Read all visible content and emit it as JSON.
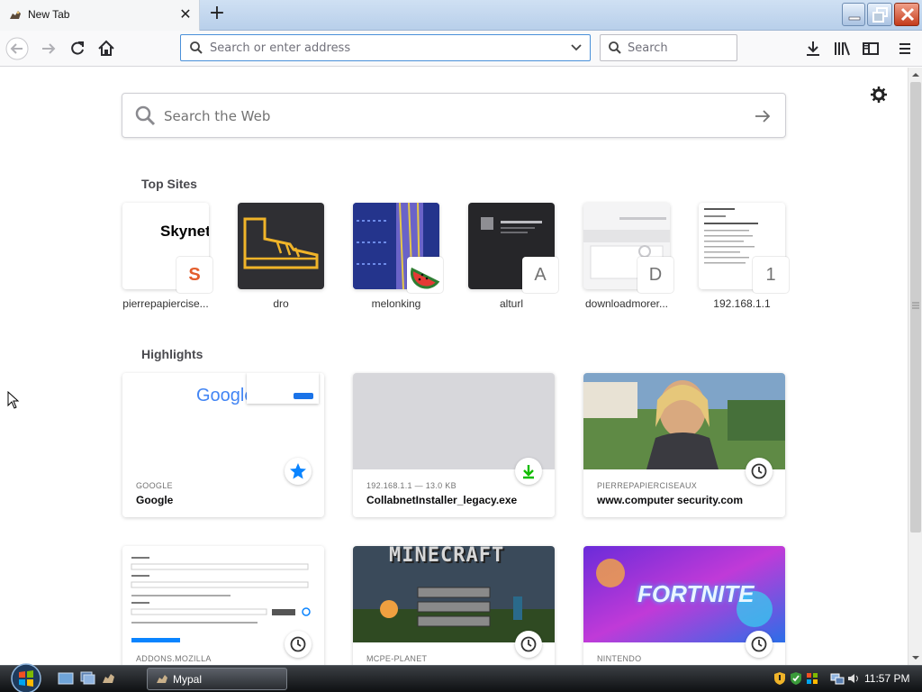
{
  "browser": {
    "tab_title": "New Tab",
    "url_placeholder": "Search or enter address",
    "search_placeholder": "Search"
  },
  "newtab": {
    "websearch_placeholder": "Search the Web",
    "top_sites_heading": "Top Sites",
    "highlights_heading": "Highlights",
    "top_sites": [
      {
        "label": "pierrepapiercise...",
        "badge": "S",
        "thumb_text": "Skynet"
      },
      {
        "label": "dro",
        "badge": ""
      },
      {
        "label": "melonking",
        "badge": ""
      },
      {
        "label": "alturl",
        "badge": "A"
      },
      {
        "label": "downloadmorer...",
        "badge": "D"
      },
      {
        "label": "192.168.1.1",
        "badge": "1"
      }
    ],
    "highlights": [
      {
        "context": "GOOGLE",
        "title": "Google",
        "thumb_text": "Google",
        "badge_icon": "star-icon"
      },
      {
        "context": "192.168.1.1 — 13.0 KB",
        "title": "CollabnetInstaller_legacy.exe",
        "badge_icon": "download-icon"
      },
      {
        "context": "PIERREPAPIERCISEAUX",
        "title": "www.computer security.com",
        "badge_icon": "clock-icon"
      },
      {
        "context": "ADDONS.MOZILLA",
        "title": "",
        "badge_icon": "clock-icon"
      },
      {
        "context": "MCPE-PLANET",
        "title": "",
        "thumb_text": "MINECRAFT",
        "badge_icon": "clock-icon"
      },
      {
        "context": "NINTENDO",
        "title": "",
        "thumb_text": "FORTNITE",
        "badge_icon": "clock-icon"
      }
    ]
  },
  "taskbar": {
    "task_label": "Mypal",
    "clock": "11:57 PM"
  }
}
